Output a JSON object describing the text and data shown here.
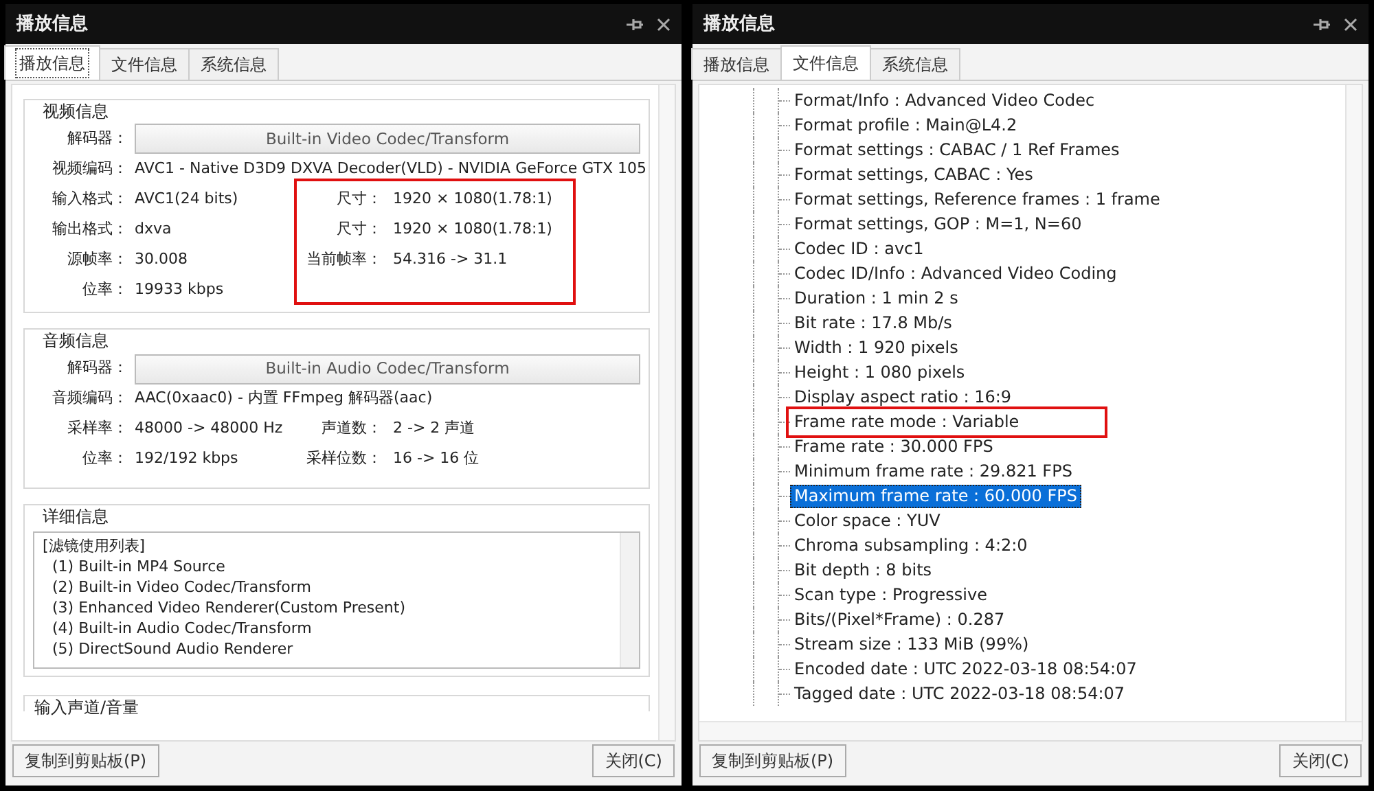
{
  "windows": [
    {
      "kind": "playback",
      "title": "播放信息",
      "tabs": [
        {
          "label": "播放信息",
          "selected": true
        },
        {
          "label": "文件信息",
          "selected": false
        },
        {
          "label": "系统信息",
          "selected": false
        }
      ],
      "sections": [
        {
          "kind": "fields",
          "title": "视频信息",
          "decoder_label": "解码器：",
          "decoder": "Built-in Video Codec/Transform",
          "full_rows": [
            {
              "label": "视频编码：",
              "value": "AVC1 - Native D3D9 DXVA Decoder(VLD) - NVIDIA GeForce GTX 105"
            }
          ],
          "left_rows": [
            {
              "label": "输入格式：",
              "value": "AVC1(24 bits)"
            },
            {
              "label": "输出格式：",
              "value": "dxva"
            },
            {
              "label": "源帧率：",
              "value": "30.008"
            },
            {
              "label": "位率：",
              "value": "19933 kbps"
            }
          ],
          "side_rows": [
            {
              "label": "尺寸：",
              "value": "1920 × 1080(1.78:1)"
            },
            {
              "label": "尺寸：",
              "value": "1920 × 1080(1.78:1)"
            },
            {
              "label": "当前帧率：",
              "value": "54.316 -> 31.1"
            }
          ],
          "side_highlighted": true
        },
        {
          "kind": "fields",
          "title": "音频信息",
          "decoder_label": "解码器：",
          "decoder": "Built-in Audio Codec/Transform",
          "full_rows": [
            {
              "label": "音频编码：",
              "value": "AAC(0xaac0) - 内置 FFmpeg 解码器(aac)"
            }
          ],
          "left_rows": [
            {
              "label": "采样率：",
              "value": "48000 -> 48000 Hz"
            },
            {
              "label": "位率：",
              "value": "192/192 kbps"
            }
          ],
          "side_rows": [
            {
              "label": "声道数：",
              "value": "2 -> 2 声道"
            },
            {
              "label": "采样位数：",
              "value": "16 -> 16 位"
            }
          ],
          "side_highlighted": false
        },
        {
          "kind": "text",
          "title": "详细信息",
          "lines": [
            "[滤镜使用列表]",
            "  (1) Built-in MP4 Source",
            "  (2) Built-in Video Codec/Transform",
            "  (3) Enhanced Video Renderer(Custom Present)",
            "  (4) Built-in Audio Codec/Transform",
            "  (5) DirectSound Audio Renderer"
          ]
        },
        {
          "kind": "cut",
          "title": "输入声道/音量"
        }
      ],
      "buttons": [
        "复制到剪贴板(P)",
        "关闭(C)"
      ]
    },
    {
      "kind": "file",
      "title": "播放信息",
      "tabs": [
        {
          "label": "播放信息",
          "selected": false
        },
        {
          "label": "文件信息",
          "selected": true
        },
        {
          "label": "系统信息",
          "selected": false
        }
      ],
      "tree_items": [
        {
          "text": "Format/Info : Advanced Video Codec",
          "selected": false,
          "highlighted": false
        },
        {
          "text": "Format profile : Main@L4.2",
          "selected": false,
          "highlighted": false
        },
        {
          "text": "Format settings : CABAC / 1 Ref Frames",
          "selected": false,
          "highlighted": false
        },
        {
          "text": "Format settings, CABAC : Yes",
          "selected": false,
          "highlighted": false
        },
        {
          "text": "Format settings, Reference frames : 1 frame",
          "selected": false,
          "highlighted": false
        },
        {
          "text": "Format settings, GOP : M=1, N=60",
          "selected": false,
          "highlighted": false
        },
        {
          "text": "Codec ID : avc1",
          "selected": false,
          "highlighted": false
        },
        {
          "text": "Codec ID/Info : Advanced Video Coding",
          "selected": false,
          "highlighted": false
        },
        {
          "text": "Duration : 1 min 2 s",
          "selected": false,
          "highlighted": false
        },
        {
          "text": "Bit rate : 17.8 Mb/s",
          "selected": false,
          "highlighted": false
        },
        {
          "text": "Width : 1 920 pixels",
          "selected": false,
          "highlighted": false
        },
        {
          "text": "Height : 1 080 pixels",
          "selected": false,
          "highlighted": false
        },
        {
          "text": "Display aspect ratio : 16:9",
          "selected": false,
          "highlighted": false
        },
        {
          "text": "Frame rate mode : Variable",
          "selected": false,
          "highlighted": true
        },
        {
          "text": "Frame rate : 30.000 FPS",
          "selected": false,
          "highlighted": false
        },
        {
          "text": "Minimum frame rate : 29.821 FPS",
          "selected": false,
          "highlighted": false
        },
        {
          "text": "Maximum frame rate : 60.000 FPS",
          "selected": true,
          "highlighted": false
        },
        {
          "text": "Color space : YUV",
          "selected": false,
          "highlighted": false
        },
        {
          "text": "Chroma subsampling : 4:2:0",
          "selected": false,
          "highlighted": false
        },
        {
          "text": "Bit depth : 8 bits",
          "selected": false,
          "highlighted": false
        },
        {
          "text": "Scan type : Progressive",
          "selected": false,
          "highlighted": false
        },
        {
          "text": "Bits/(Pixel*Frame) : 0.287",
          "selected": false,
          "highlighted": false
        },
        {
          "text": "Stream size : 133 MiB (99%)",
          "selected": false,
          "highlighted": false
        },
        {
          "text": "Encoded date : UTC 2022-03-18 08:54:07",
          "selected": false,
          "highlighted": false
        },
        {
          "text": "Tagged date : UTC 2022-03-18 08:54:07",
          "selected": false,
          "highlighted": false
        }
      ],
      "buttons": [
        "复制到剪贴板(P)",
        "关闭(C)"
      ]
    }
  ]
}
